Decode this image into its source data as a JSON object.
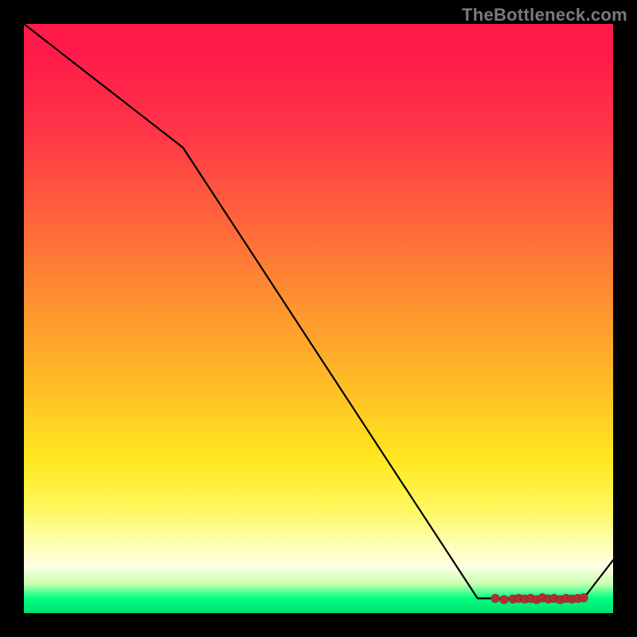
{
  "watermark": "TheBottleneck.com",
  "colors": {
    "background": "#000000",
    "line": "#000000",
    "datapoint": "#b22f2f",
    "gradient_top": "#ff1a4a",
    "gradient_mid": "#ffe81f",
    "gradient_bottom": "#00e070"
  },
  "chart_data": {
    "type": "line",
    "title": "",
    "xlabel": "",
    "ylabel": "",
    "xlim": [
      0,
      100
    ],
    "ylim": [
      0,
      100
    ],
    "grid": false,
    "legend": false,
    "x": [
      0,
      27,
      77,
      80,
      83,
      86,
      89,
      92,
      95,
      100
    ],
    "values": [
      100,
      79,
      2.5,
      2.5,
      2.5,
      2.5,
      2.5,
      2.5,
      2.5,
      9
    ],
    "marker_points_x": [
      80,
      81.5,
      83,
      84,
      85,
      86,
      87,
      88,
      89,
      90,
      91,
      92,
      93,
      94,
      95
    ],
    "marker_points_y": [
      2.5,
      2.3,
      2.4,
      2.5,
      2.4,
      2.5,
      2.3,
      2.6,
      2.4,
      2.5,
      2.3,
      2.5,
      2.4,
      2.5,
      2.6
    ],
    "notes": "Values are approximate, read off from pixel positions. x=0..100 spans plot width; y=0..100 spans plot height (0 at bottom). Line descends from top-left with slope change near x≈27, reaches floor ≈2.5 around x≈77–95 (where markers cluster), then rises slightly to ≈9 at x=100."
  }
}
